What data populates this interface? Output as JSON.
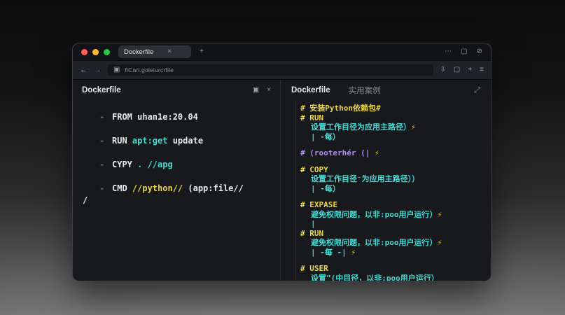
{
  "browser": {
    "tab_title": "Dockerfile",
    "url": "fiCari.goleiurcrfile"
  },
  "icons": {
    "tab_close": "×",
    "new_tab": "+",
    "more": "⋯",
    "win": "▢",
    "overflow": "⊘",
    "back": "←",
    "forward": "→",
    "site": "▣",
    "download": "⇩",
    "window2": "▢",
    "plus": "+",
    "menu": "≡",
    "panel": "▣",
    "panel_close": "×",
    "expand": "⤢"
  },
  "left_pane": {
    "title": "Dockerfile",
    "marker": "-",
    "lines": [
      {
        "marker": true,
        "parts": [
          {
            "t": "FROM uhan1e:20.04",
            "c": "white"
          }
        ]
      },
      {
        "marker": true,
        "parts": [
          {
            "t": "RUN ",
            "c": "white"
          },
          {
            "t": "apt:get",
            "c": "cyan"
          },
          {
            "t": " update",
            "c": "white"
          }
        ]
      },
      {
        "marker": true,
        "parts": [
          {
            "t": "CYPY ",
            "c": "white"
          },
          {
            "t": ". //apg",
            "c": "cyan"
          }
        ]
      },
      {
        "marker": true,
        "parts": [
          {
            "t": "CMD ",
            "c": "white"
          },
          {
            "t": "//python//",
            "c": "yellow"
          },
          {
            "t": " (app:file//",
            "c": "white"
          }
        ]
      },
      {
        "marker": false,
        "parts": [
          {
            "t": "/",
            "c": "white"
          }
        ]
      }
    ]
  },
  "right_pane": {
    "tabs": [
      {
        "label": "Dockerfile"
      },
      {
        "label": "实用案例"
      }
    ],
    "lines": [
      {
        "indent": 0,
        "parts": [
          {
            "t": "# 安装Python依赖包#",
            "c": "yellow"
          }
        ]
      },
      {
        "indent": 0,
        "parts": [
          {
            "t": "# RUN",
            "c": "yellow"
          }
        ]
      },
      {
        "indent": 1,
        "parts": [
          {
            "t": "设置工作目径为应用主路径）",
            "c": "cyan"
          },
          {
            "t": "⚡",
            "c": "bolt"
          }
        ]
      },
      {
        "indent": 1,
        "parts": [
          {
            "t": "| -每）",
            "c": "cyan"
          }
        ]
      },
      {
        "gap": true
      },
      {
        "indent": 0,
        "parts": [
          {
            "t": "# (rooterhér (| ",
            "c": "purple"
          },
          {
            "t": "⚡",
            "c": "bolt"
          }
        ]
      },
      {
        "gap": true
      },
      {
        "indent": 0,
        "parts": [
          {
            "t": "# COPY",
            "c": "yellow"
          }
        ]
      },
      {
        "indent": 1,
        "parts": [
          {
            "t": "设置工作目径⁻为应用主路径））",
            "c": "cyan"
          }
        ]
      },
      {
        "indent": 1,
        "parts": [
          {
            "t": "| -每）",
            "c": "cyan"
          }
        ]
      },
      {
        "gap": true
      },
      {
        "indent": 0,
        "parts": [
          {
            "t": "# EXPASE",
            "c": "yellow"
          }
        ]
      },
      {
        "indent": 1,
        "parts": [
          {
            "t": "避免权限问题，以非:poo用户运行）",
            "c": "cyan"
          },
          {
            "t": "⚡",
            "c": "bolt"
          }
        ]
      },
      {
        "indent": 1,
        "parts": [
          {
            "t": "|",
            "c": "cyan"
          }
        ]
      },
      {
        "indent": 0,
        "parts": [
          {
            "t": "# RUN",
            "c": "yellow"
          }
        ]
      },
      {
        "indent": 1,
        "parts": [
          {
            "t": "避免权限问题，以非:poo用户运行）",
            "c": "cyan"
          },
          {
            "t": "⚡",
            "c": "bolt"
          }
        ]
      },
      {
        "indent": 1,
        "parts": [
          {
            "t": "| -每 -| ",
            "c": "cyan"
          },
          {
            "t": "⚡",
            "c": "bolt"
          }
        ]
      },
      {
        "gap": true
      },
      {
        "indent": 0,
        "parts": [
          {
            "t": "# USER",
            "c": "yellow"
          }
        ]
      },
      {
        "indent": 1,
        "parts": [
          {
            "t": "设置\"(中目径，以非:poo用户运行）",
            "c": "cyan"
          }
        ]
      }
    ]
  }
}
